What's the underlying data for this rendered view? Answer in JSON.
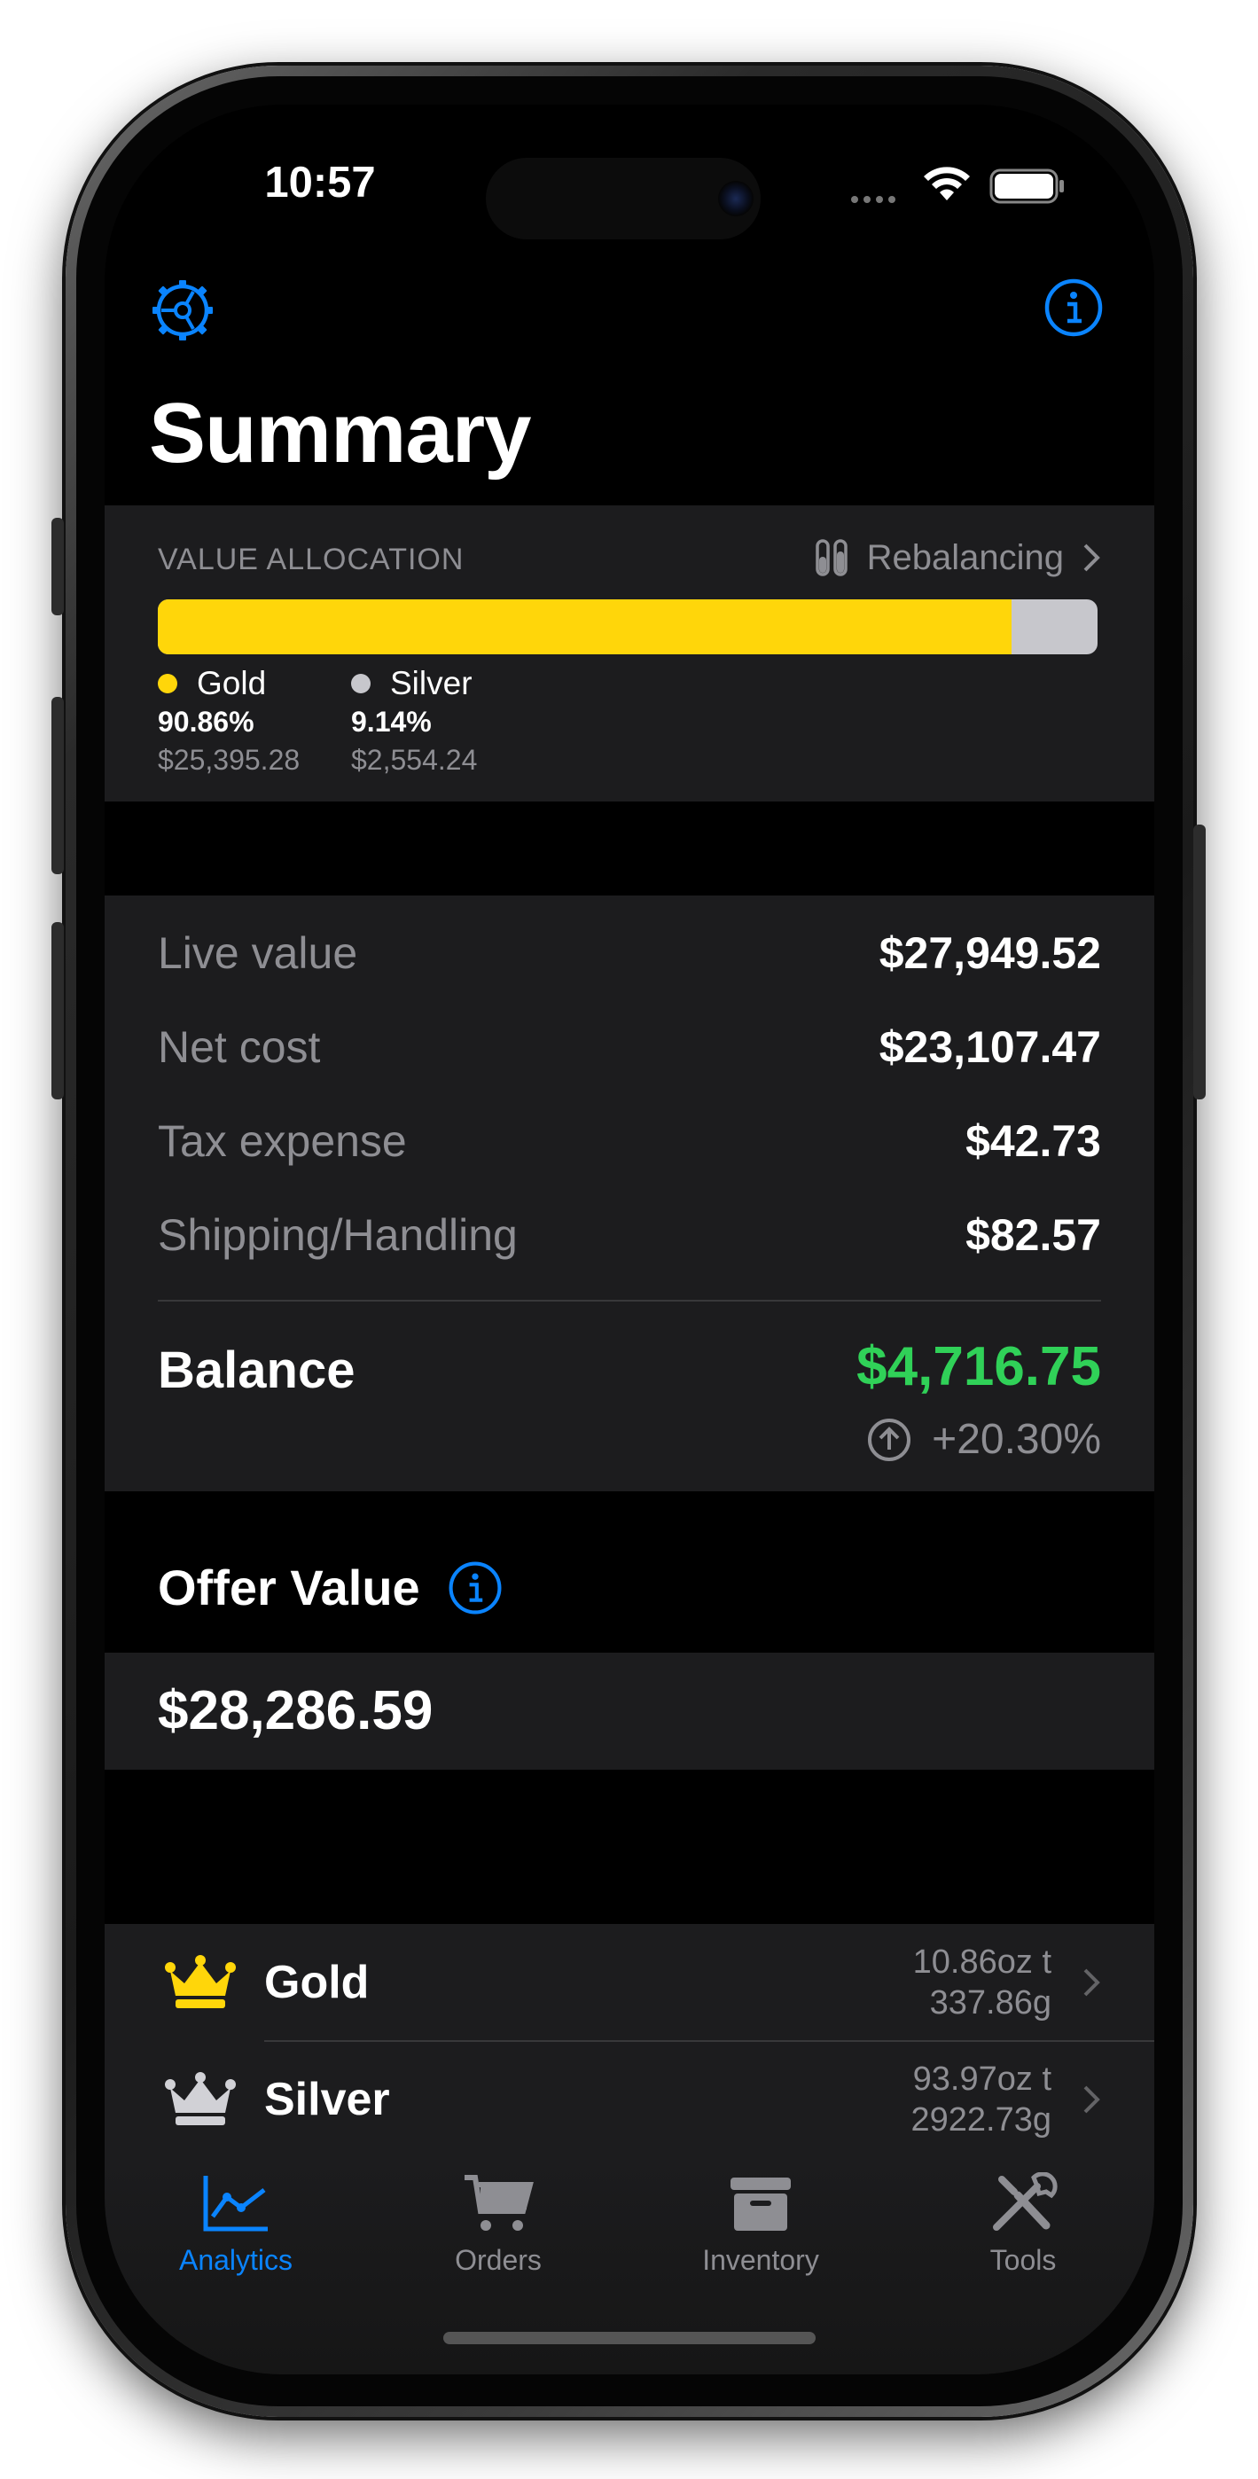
{
  "status": {
    "time": "10:57"
  },
  "header": {
    "title": "Summary"
  },
  "allocation": {
    "header": "VALUE ALLOCATION",
    "rebalancing_label": "Rebalancing",
    "gold_fraction": 0.9086,
    "items": [
      {
        "name": "Gold",
        "percent": "90.86%",
        "amount": "$25,395.28",
        "color": "#ffd60a"
      },
      {
        "name": "Silver",
        "percent": "9.14%",
        "amount": "$2,554.24",
        "color": "#c7c7cc"
      }
    ]
  },
  "totals": {
    "rows": [
      {
        "label": "Live value",
        "value": "$27,949.52"
      },
      {
        "label": "Net cost",
        "value": "$23,107.47"
      },
      {
        "label": "Tax expense",
        "value": "$42.73"
      },
      {
        "label": "Shipping/Handling",
        "value": "$82.57"
      }
    ],
    "balance_label": "Balance",
    "balance_value": "$4,716.75",
    "balance_percent": "+20.30%",
    "balance_color": "#30d158"
  },
  "offer": {
    "title": "Offer Value",
    "value": "$28,286.59"
  },
  "metals": [
    {
      "name": "Gold",
      "oz": "10.86oz t",
      "grams": "337.86g",
      "icon": "crown-icon",
      "color": "#ffd60a"
    },
    {
      "name": "Silver",
      "oz": "93.97oz t",
      "grams": "2922.73g",
      "icon": "crown-icon",
      "color": "#d1d1d6"
    }
  ],
  "tabs": [
    {
      "label": "Analytics",
      "icon": "chart-icon",
      "active": true
    },
    {
      "label": "Orders",
      "icon": "cart-icon",
      "active": false
    },
    {
      "label": "Inventory",
      "icon": "archive-box-icon",
      "active": false
    },
    {
      "label": "Tools",
      "icon": "tools-icon",
      "active": false
    }
  ],
  "accent_color": "#0a84ff"
}
